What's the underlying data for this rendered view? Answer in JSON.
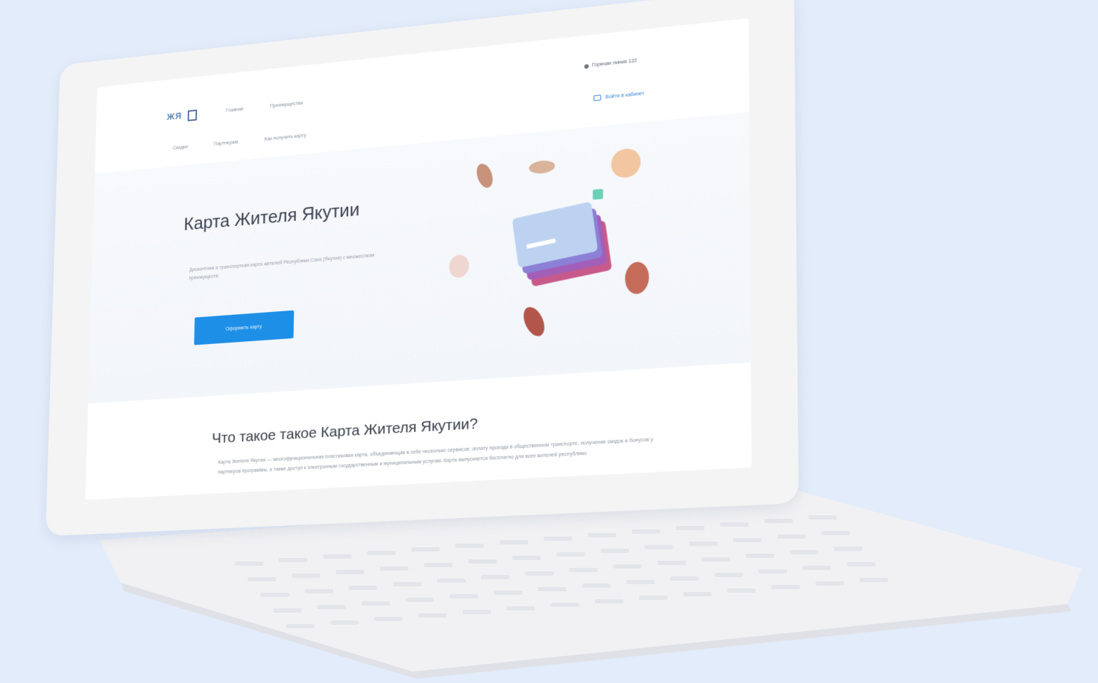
{
  "header": {
    "logo_text": "ЖЯ",
    "nav_top": [
      "Главная",
      "Преимущества"
    ],
    "nav_bottom": [
      "Скидки",
      "Партнерам",
      "Как получить карту"
    ],
    "contact_label": "Горячая линия 122",
    "login_label": "Войти в кабинет"
  },
  "hero": {
    "title": "Карта Жителя Якутии",
    "subtitle": "Дисконтная и транспортная карта жителей Республики Саха (Якутия) с множеством преимуществ",
    "button_label": "Оформить карту"
  },
  "about": {
    "title": "Что такое такое Карта Жителя Якутии?",
    "text": "Карта Жителя Якутии — многофункциональная пластиковая карта, объединяющая в себе несколько сервисов: оплату проезда в общественном транспорте, получение скидок и бонусов у партнеров программы, а также доступ к электронным государственным и муниципальным услугам. Карта выпускается бесплатно для всех жителей республики."
  },
  "colors": {
    "accent": "#1e8fe6",
    "background": "#e3ecfa",
    "laptop_body": "#f4f4f5"
  }
}
